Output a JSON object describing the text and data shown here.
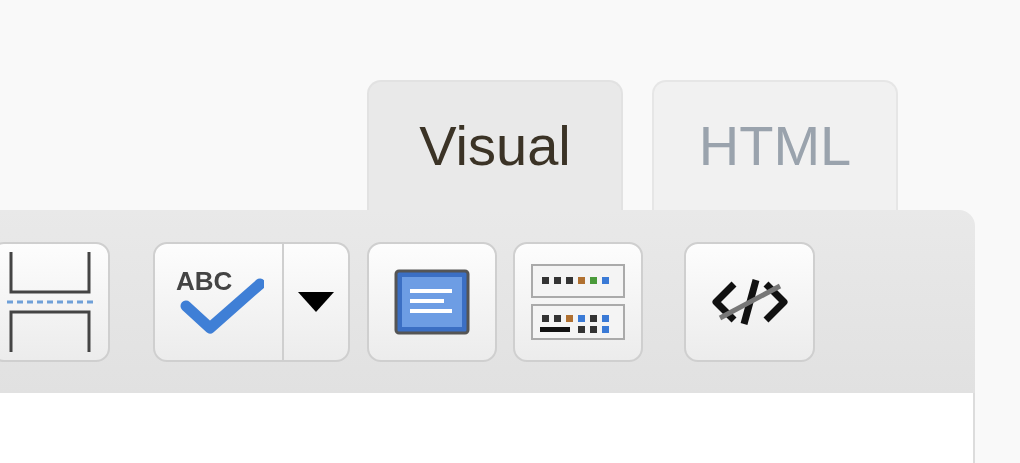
{
  "tabs": [
    {
      "label": "Visual",
      "selected": true
    },
    {
      "label": "HTML",
      "selected": false
    }
  ],
  "spellcheck_icon_text": "ABC"
}
